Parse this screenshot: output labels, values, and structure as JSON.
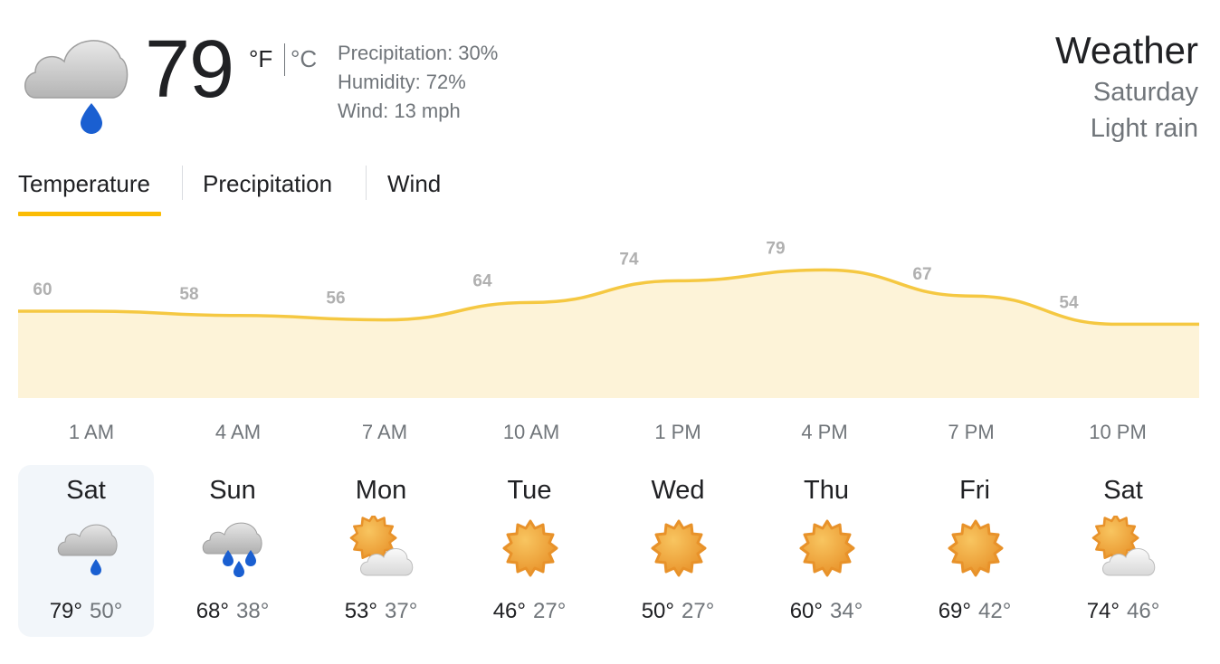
{
  "current": {
    "icon": "rain-cloud-icon",
    "temperature": "79",
    "unit_f": "°F",
    "unit_c": "°C",
    "precipitation": "Precipitation: 30%",
    "humidity": "Humidity: 72%",
    "wind": "Wind: 13 mph"
  },
  "header": {
    "title": "Weather",
    "day": "Saturday",
    "condition": "Light rain"
  },
  "tabs": [
    {
      "label": "Temperature",
      "active": true
    },
    {
      "label": "Precipitation",
      "active": false
    },
    {
      "label": "Wind",
      "active": false
    }
  ],
  "colors": {
    "accent": "#fbbc04",
    "chart_line": "#f5c842",
    "chart_fill": "#fdf3d8",
    "rain_drop": "#1a5fd1",
    "sun": "#f0a93a"
  },
  "chart_data": {
    "type": "area",
    "x": [
      "1 AM",
      "4 AM",
      "7 AM",
      "10 AM",
      "1 PM",
      "4 PM",
      "7 PM",
      "10 PM"
    ],
    "values": [
      60,
      58,
      56,
      64,
      74,
      79,
      67,
      54
    ],
    "xlabel": "",
    "ylabel": "",
    "grid": false
  },
  "forecast": [
    {
      "day": "Sat",
      "icon": "rain-cloud-icon",
      "high": "79°",
      "low": "50°",
      "selected": true
    },
    {
      "day": "Sun",
      "icon": "heavy-rain-cloud-icon",
      "high": "68°",
      "low": "38°",
      "selected": false
    },
    {
      "day": "Mon",
      "icon": "partly-cloudy-icon",
      "high": "53°",
      "low": "37°",
      "selected": false
    },
    {
      "day": "Tue",
      "icon": "sun-icon",
      "high": "46°",
      "low": "27°",
      "selected": false
    },
    {
      "day": "Wed",
      "icon": "sun-icon",
      "high": "50°",
      "low": "27°",
      "selected": false
    },
    {
      "day": "Thu",
      "icon": "sun-icon",
      "high": "60°",
      "low": "34°",
      "selected": false
    },
    {
      "day": "Fri",
      "icon": "sun-icon",
      "high": "69°",
      "low": "42°",
      "selected": false
    },
    {
      "day": "Sat",
      "icon": "partly-cloudy-icon",
      "high": "74°",
      "low": "46°",
      "selected": false
    }
  ]
}
